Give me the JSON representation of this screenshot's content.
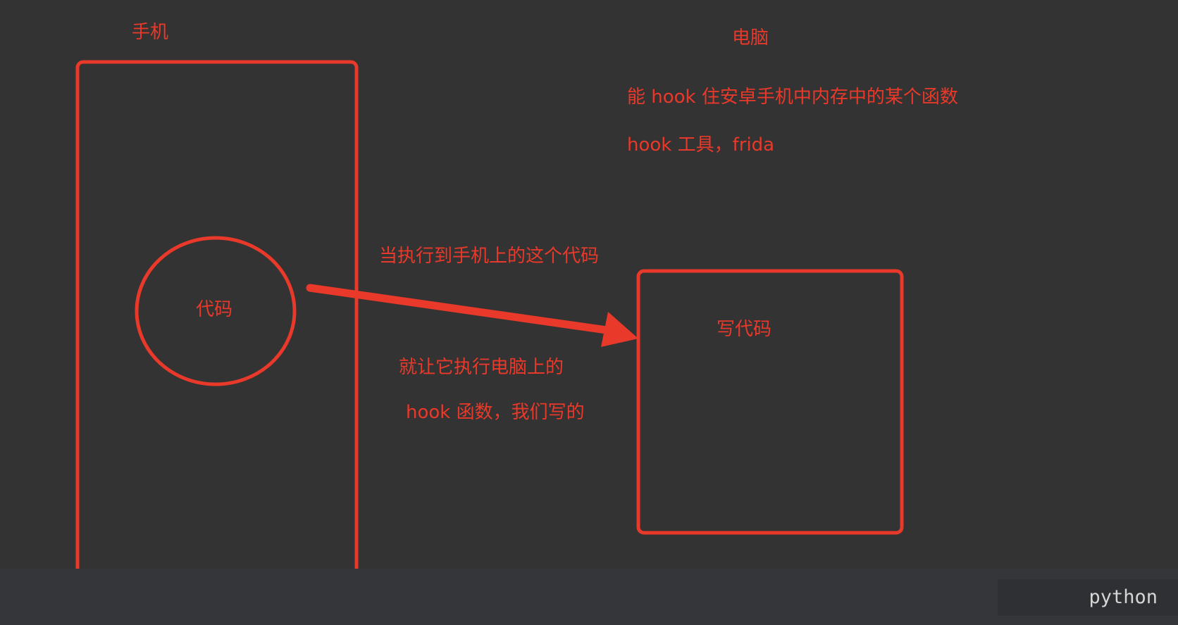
{
  "diagram": {
    "phone_title": "手机",
    "computer_title": "电脑",
    "hook_desc": "能 hook 住安卓手机中内存中的某个函数",
    "hook_tool": "hook 工具，frida",
    "code_label": "代码",
    "write_code_label": "写代码",
    "arrow_top_label": "当执行到手机上的这个代码",
    "arrow_bottom_label_1": "就让它执行电脑上的",
    "arrow_bottom_label_2": "hook 函数，我们写的"
  },
  "code_block": {
    "language": "python"
  },
  "colors": {
    "background": "#333333",
    "accent_red": "#e8392a",
    "bottom_bar": "#35363a",
    "badge_bg": "#2f3034",
    "badge_text": "#d6d6d6"
  }
}
